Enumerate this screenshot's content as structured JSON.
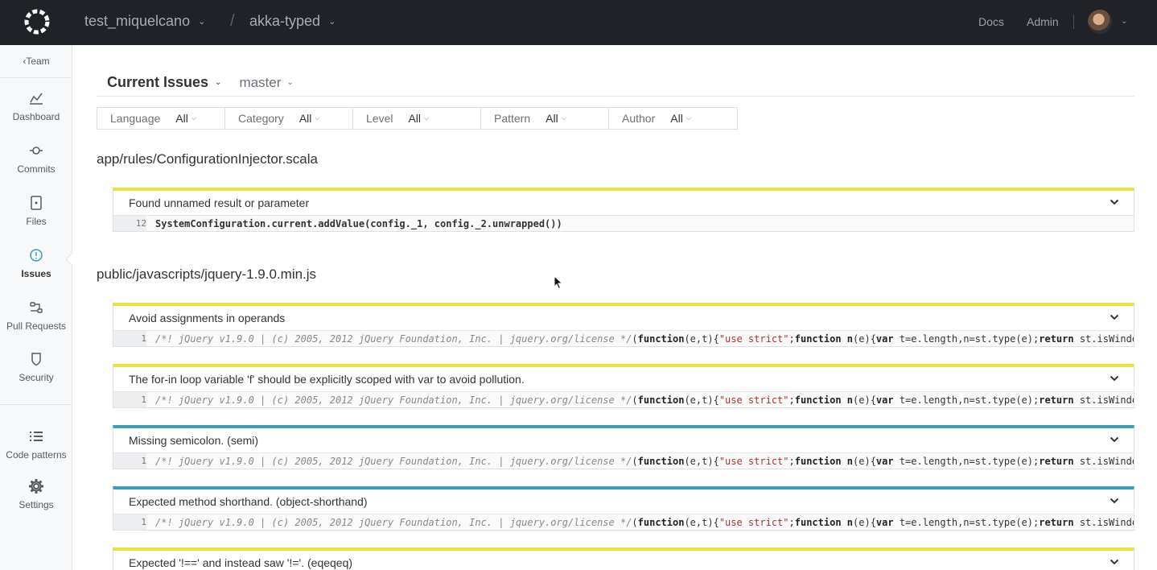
{
  "topbar": {
    "org": "test_miquelcano",
    "separator": "/",
    "repo": "akka-typed",
    "links": [
      "Docs",
      "Admin"
    ]
  },
  "sidebar": {
    "back": "Team",
    "items": [
      {
        "label": "Dashboard",
        "icon": "chart-icon"
      },
      {
        "label": "Commits",
        "icon": "commit-icon"
      },
      {
        "label": "Files",
        "icon": "file-icon"
      },
      {
        "label": "Issues",
        "icon": "issue-icon",
        "active": true
      },
      {
        "label": "Pull Requests",
        "icon": "pull-request-icon"
      },
      {
        "label": "Security",
        "icon": "shield-icon"
      },
      {
        "label": "Code patterns",
        "icon": "list-icon"
      },
      {
        "label": "Settings",
        "icon": "gear-icon"
      }
    ]
  },
  "header": {
    "view": "Current Issues",
    "branch": "master"
  },
  "filters": [
    {
      "name": "Language",
      "value": "All"
    },
    {
      "name": "Category",
      "value": "All"
    },
    {
      "name": "Level",
      "value": "All"
    },
    {
      "name": "Pattern",
      "value": "All"
    },
    {
      "name": "Author",
      "value": "All"
    }
  ],
  "files": [
    {
      "path": "app/rules/ConfigurationInjector.scala",
      "issues": [
        {
          "title": "Found unnamed result or parameter",
          "level_color": "#e8e33b",
          "line": "12",
          "code": "SystemConfiguration.current.addValue(config._1, config._2.unwrapped())"
        }
      ]
    },
    {
      "path": "public/javascripts/jquery-1.9.0.min.js",
      "issues": [
        {
          "title": "Avoid assignments in operands",
          "level_color": "#e8e33b",
          "line": "1"
        },
        {
          "title": "The for-in loop variable 'f' should be explicitly scoped with var to avoid pollution.",
          "level_color": "#e8e33b",
          "line": "1"
        },
        {
          "title": "Missing semicolon. (semi)",
          "level_color": "#3aa0b3",
          "line": "1"
        },
        {
          "title": "Expected method shorthand. (object-shorthand)",
          "level_color": "#3aa0b3",
          "line": "1"
        },
        {
          "title": "Expected '!==' and instead saw '!='. (eqeqeq)",
          "level_color": "#e8e33b",
          "line": ""
        }
      ],
      "code": {
        "comment": "/*! jQuery v1.9.0 | (c) 2005, 2012 jQuery Foundation, Inc. | jquery.org/license */",
        "p1": "(",
        "kw_function": "function",
        "p2": "(e,t){",
        "str": "\"use strict\"",
        "p3": ";",
        "p4": " ",
        "fn_n": "n",
        "p5": "(e){",
        "kw_var": "var",
        "p6": " t=e.length,n=st.type(e);",
        "kw_return": "return",
        "p7": " st.isWindo"
      }
    }
  ]
}
